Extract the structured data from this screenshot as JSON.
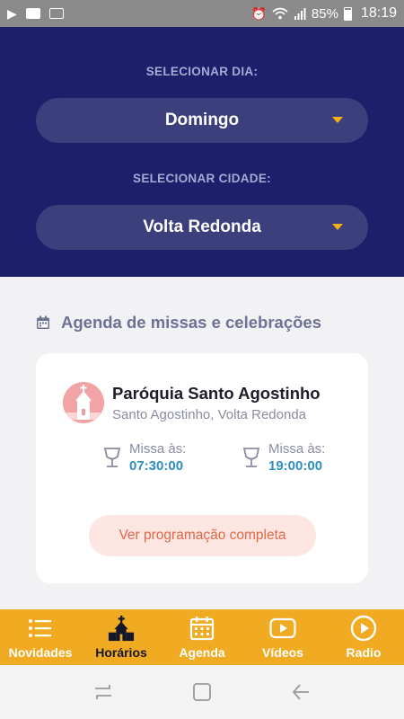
{
  "status_bar": {
    "battery": "85%",
    "time": "18:19"
  },
  "filters": {
    "day_label": "SELECIONAR DIA:",
    "day_value": "Domingo",
    "city_label": "SELECIONAR CIDADE:",
    "city_value": "Volta Redonda"
  },
  "section": {
    "title": "Agenda de missas e celebrações"
  },
  "card": {
    "name": "Paróquia Santo Agostinho",
    "location": "Santo Agostinho, Volta Redonda",
    "masses": [
      {
        "label": "Missa às:",
        "time": "07:30:00"
      },
      {
        "label": "Missa às:",
        "time": "19:00:00"
      }
    ],
    "button": "Ver programação completa"
  },
  "nav": {
    "items": [
      {
        "label": "Novidades",
        "icon": "list-icon"
      },
      {
        "label": "Horários",
        "icon": "church-icon"
      },
      {
        "label": "Agenda",
        "icon": "calendar-icon"
      },
      {
        "label": "Vídeos",
        "icon": "video-icon"
      },
      {
        "label": "Radio",
        "icon": "play-circle-icon"
      }
    ],
    "active": "Horários"
  },
  "colors": {
    "header": "#1c1f6a",
    "accent": "#f0ab22",
    "link": "#2e8ec4",
    "button_text": "#e0684a"
  }
}
